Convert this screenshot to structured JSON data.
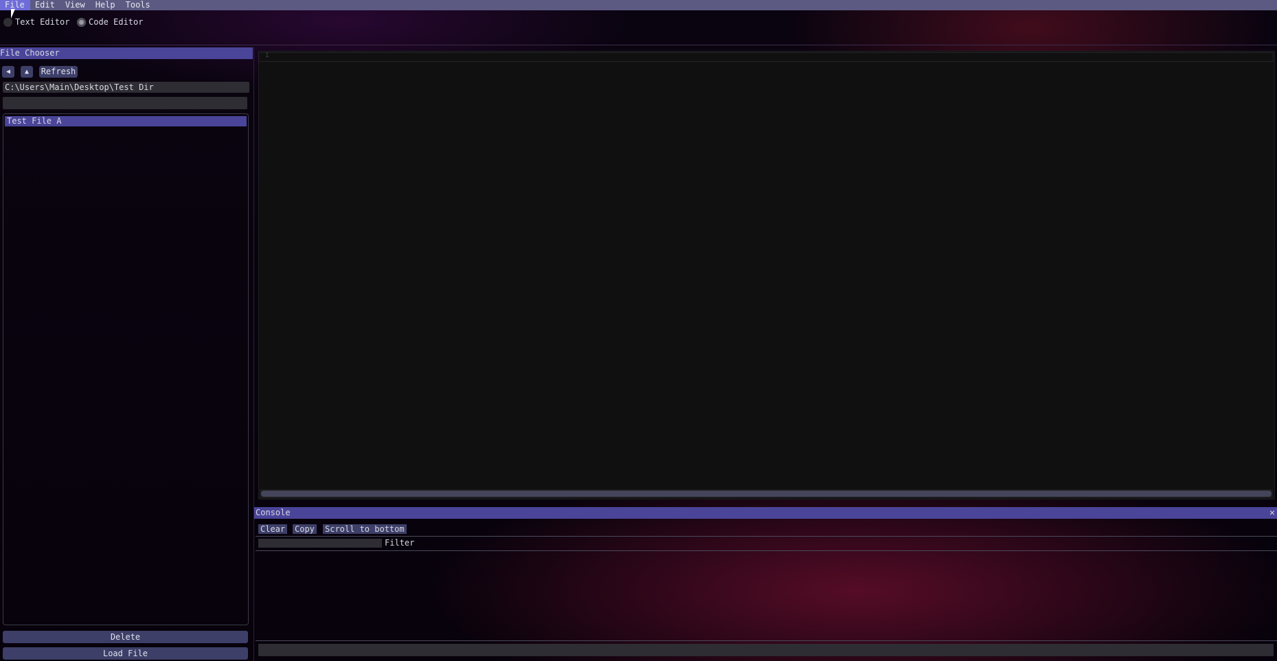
{
  "menu": {
    "items": [
      {
        "label": "File",
        "active": true
      },
      {
        "label": "Edit"
      },
      {
        "label": "View"
      },
      {
        "label": "Help"
      },
      {
        "label": "Tools"
      }
    ]
  },
  "mode": {
    "text_editor": "Text Editor",
    "code_editor": "Code Editor",
    "selected": "Code Editor"
  },
  "file_chooser": {
    "title": "File Chooser",
    "back_icon": "◀",
    "up_icon": "▲",
    "refresh_label": "Refresh",
    "path": "C:\\Users\\Main\\Desktop\\Test Dir",
    "filter_value": "",
    "files": [
      "Test File A"
    ],
    "delete_label": "Delete",
    "load_label": "Load File"
  },
  "editor": {
    "line_number": "1",
    "content": ""
  },
  "console": {
    "title": "Console",
    "close_icon": "✕",
    "clear_label": "Clear",
    "copy_label": "Copy",
    "scroll_label": "Scroll to bottom",
    "filter_label": "Filter",
    "filter_value": "",
    "input_value": ""
  },
  "colors": {
    "title_bar": "#4a4599",
    "menu_bar": "#5c5a82",
    "menu_active": "#6d6cd8",
    "button": "#3d3f68",
    "field": "#2e2d33",
    "editor_bg": "#101010"
  }
}
